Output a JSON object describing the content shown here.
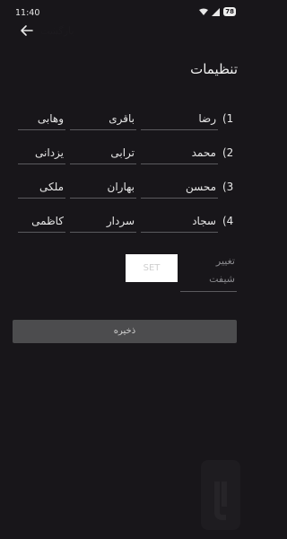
{
  "status": {
    "time": "11:40",
    "battery": "78"
  },
  "header": {
    "back_label": "بازگشت"
  },
  "settings": {
    "title": "تنظیمات",
    "rows": [
      {
        "num": "(1",
        "first": "رضا",
        "middle": "باقری",
        "last": "وهابی"
      },
      {
        "num": "(2",
        "first": "محمد",
        "middle": "ترابی",
        "last": "یزدانی"
      },
      {
        "num": "(3",
        "first": "محسن",
        "middle": "بهاران",
        "last": "ملکی"
      },
      {
        "num": "(4",
        "first": "سجاد",
        "middle": "سردار",
        "last": "کاظمی"
      }
    ],
    "shift_placeholder_line1": "تغییر",
    "shift_placeholder_line2": "شیفت",
    "set_label": "SET",
    "save_label": "ذخیره"
  },
  "colors": {
    "background": "#18161a",
    "save_button": "#4c4c4e",
    "set_button": "#ffffff"
  }
}
